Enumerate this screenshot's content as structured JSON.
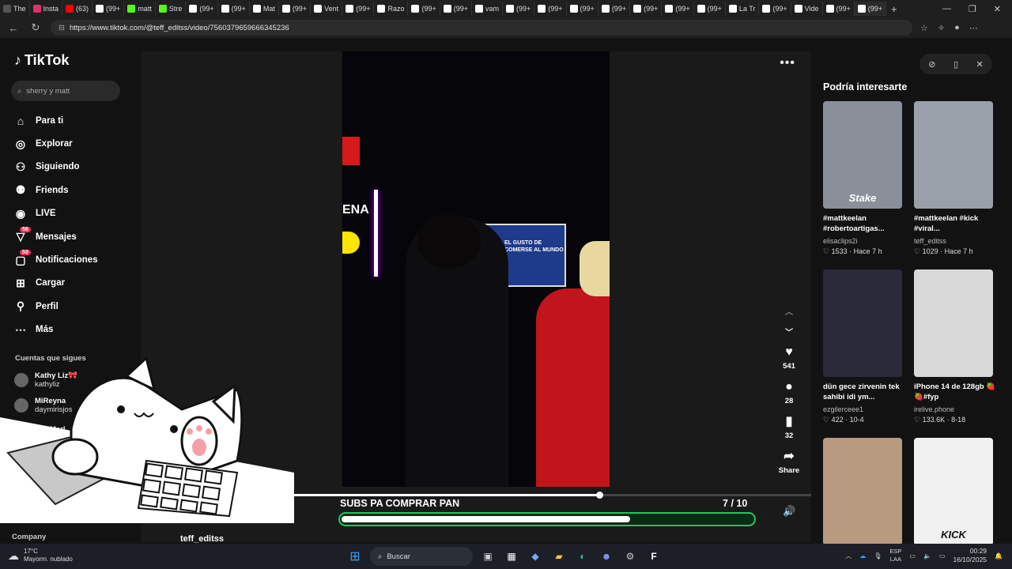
{
  "browser": {
    "tabs": [
      {
        "label": "The",
        "color": "#555"
      },
      {
        "label": "Insta",
        "color": "#e1306c"
      },
      {
        "label": "(63)",
        "color": "#ff0000"
      },
      {
        "label": "(99+",
        "color": "#fff"
      },
      {
        "label": "matt",
        "color": "#53fc18"
      },
      {
        "label": "Stre",
        "color": "#53fc18"
      },
      {
        "label": "(99+",
        "color": "#fff"
      },
      {
        "label": "(99+",
        "color": "#fff"
      },
      {
        "label": "Mat",
        "color": "#fff"
      },
      {
        "label": "(99+",
        "color": "#fff"
      },
      {
        "label": "Vent",
        "color": "#fff"
      },
      {
        "label": "(99+",
        "color": "#fff"
      },
      {
        "label": "Razo",
        "color": "#fff"
      },
      {
        "label": "(99+",
        "color": "#fff"
      },
      {
        "label": "(99+",
        "color": "#fff"
      },
      {
        "label": "vam",
        "color": "#fff"
      },
      {
        "label": "(99+",
        "color": "#fff"
      },
      {
        "label": "(99+",
        "color": "#fff"
      },
      {
        "label": "(99+",
        "color": "#fff"
      },
      {
        "label": "(99+",
        "color": "#fff"
      },
      {
        "label": "(99+",
        "color": "#fff"
      },
      {
        "label": "(99+",
        "color": "#fff"
      },
      {
        "label": "(99+",
        "color": "#fff"
      },
      {
        "label": "La Tr",
        "color": "#fff"
      },
      {
        "label": "(99+",
        "color": "#fff"
      },
      {
        "label": "Vide",
        "color": "#fff"
      },
      {
        "label": "(99+",
        "color": "#fff"
      },
      {
        "label": "(99+",
        "color": "#fff"
      }
    ],
    "url": "https://www.tiktok.com/@teff_editss/video/7560379659666345236"
  },
  "sidebar": {
    "brand": "TikTok",
    "search_placeholder": "sherry y matt",
    "nav": [
      {
        "label": "Para ti",
        "icon": "home-icon",
        "glyph": "⌂"
      },
      {
        "label": "Explorar",
        "icon": "compass-icon",
        "glyph": "◎"
      },
      {
        "label": "Siguiendo",
        "icon": "following-icon",
        "glyph": "⚇"
      },
      {
        "label": "Friends",
        "icon": "friends-icon",
        "glyph": "⚉"
      },
      {
        "label": "LIVE",
        "icon": "live-icon",
        "glyph": "◉"
      },
      {
        "label": "Mensajes",
        "icon": "messages-icon",
        "glyph": "▽",
        "badge": "56"
      },
      {
        "label": "Notificaciones",
        "icon": "notifications-icon",
        "glyph": "▢",
        "badge": "53"
      },
      {
        "label": "Cargar",
        "icon": "upload-icon",
        "glyph": "⊞"
      },
      {
        "label": "Perfil",
        "icon": "profile-icon",
        "glyph": "⚲"
      },
      {
        "label": "Más",
        "icon": "more-icon",
        "glyph": "⋯"
      }
    ],
    "following_title": "Cuentas que sigues",
    "following": [
      {
        "name": "Kathy Liz🎀",
        "handle": "kathyliz"
      },
      {
        "name": "MiReyna",
        "handle": "daymirisjos"
      },
      {
        "name": "ladyMarl",
        "handle": ""
      }
    ],
    "company": "Company"
  },
  "video": {
    "overlay_title": "SUBS PA COMPRAR PAN",
    "subs_current": "7",
    "subs_total": "/ 10",
    "progress_fraction": 0.59,
    "subs_fraction": 0.7,
    "sign_text": "EL GUSTO DE COMERSE AL MUNDO",
    "ena_text": "ENA",
    "channel": "teff_editss",
    "likes": "541",
    "comments": "28",
    "saves": "32",
    "share_label": "Share"
  },
  "recommendations": {
    "title": "Podría interesarte",
    "items": [
      {
        "caption": "#mattkeelan #robertoartigas...",
        "author": "elisaclips2i",
        "likes": "1533",
        "time": "Hace 7 h",
        "color": "#8a8f9a",
        "overlay": "Stake"
      },
      {
        "caption": "#mattkeelan #kick #viral...",
        "author": "teff_editss",
        "likes": "1029",
        "time": "Hace 7 h",
        "color": "#9aa0aa",
        "overlay": ""
      },
      {
        "caption": "dün gece zirvenin tek sahibi idi ym...",
        "author": "ezgilerceee1",
        "likes": "422",
        "time": "10-4",
        "color": "#2a2a3a",
        "overlay": ""
      },
      {
        "caption": "iPhone 14 de 128gb 🍓🍓#fyp",
        "author": "irelive.phone",
        "likes": "133.6K",
        "time": "8-18",
        "color": "#d8d8d8",
        "overlay": ""
      },
      {
        "caption": "",
        "author": "",
        "likes": "",
        "time": "",
        "color": "#b89a80",
        "overlay": ""
      },
      {
        "caption": "",
        "author": "",
        "likes": "",
        "time": "",
        "color": "#f0f0f0",
        "overlay": "KICK"
      }
    ]
  },
  "taskbar": {
    "temp": "17°C",
    "weather": "Mayorm. nublado",
    "search_label": "Buscar",
    "lang": "ESP",
    "lang2": "LAA",
    "time": "00:29",
    "date": "16/10/2025"
  }
}
